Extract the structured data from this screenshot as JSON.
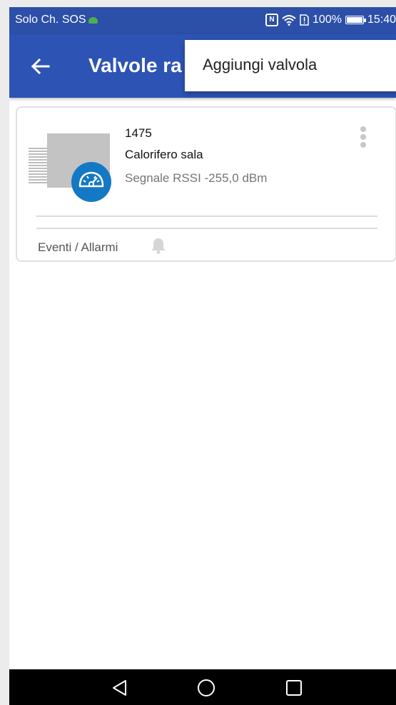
{
  "status_bar": {
    "carrier": "Solo Ch. SOS",
    "battery": "100%",
    "time": "15:40"
  },
  "app_bar": {
    "title": "Valvole ra"
  },
  "menu": {
    "items": [
      {
        "label": "Aggiungi valvola"
      }
    ]
  },
  "card": {
    "id": "1475",
    "name": "Calorifero sala",
    "signal": "Segnale RSSI -255,0 dBm",
    "events_label": "Eventi / Allarmi"
  },
  "colors": {
    "app_bar": "#2d53b5",
    "status_bar": "#2c4fa8",
    "badge": "#1479c4"
  },
  "icons": {
    "back": "arrow-left-icon",
    "overflow": "more-vert-icon",
    "bell": "bell-icon",
    "gauge": "gauge-icon",
    "nav_back": "triangle-back-icon",
    "nav_home": "circle-home-icon",
    "nav_recent": "square-recent-icon"
  }
}
